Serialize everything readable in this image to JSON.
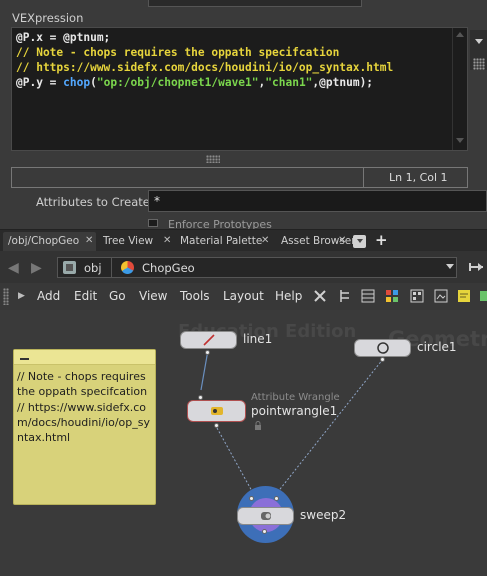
{
  "parameter_pane": {
    "vex_label": "VEXpression",
    "code_lines": [
      [
        {
          "t": "@P.x = @ptnum;",
          "c": "plain"
        }
      ],
      [
        {
          "t": "// Note - chops requires the oppath specifcation",
          "c": "comment"
        }
      ],
      [
        {
          "t": "// https://www.sidefx.com/docs/houdini/io/op_syntax.html",
          "c": "comment"
        }
      ],
      [
        {
          "t": "@P.y = ",
          "c": "plain"
        },
        {
          "t": "chop",
          "c": "func"
        },
        {
          "t": "(",
          "c": "plain"
        },
        {
          "t": "\"op:/obj/chopnet1/wave1\"",
          "c": "str"
        },
        {
          "t": ",",
          "c": "plain"
        },
        {
          "t": "\"chan1\"",
          "c": "str"
        },
        {
          "t": ",@ptnum);",
          "c": "plain"
        }
      ]
    ],
    "cursor_status": "Ln 1, Col 1",
    "attributes_label": "Attributes to Create",
    "attributes_value": "*",
    "enforce_label": "Enforce Prototypes"
  },
  "tabs": [
    {
      "label": "/obj/ChopGeo",
      "active": true
    },
    {
      "label": "Tree View",
      "active": false
    },
    {
      "label": "Material Palette",
      "active": false
    },
    {
      "label": "Asset Browser",
      "active": false
    }
  ],
  "tab_add_label": "+",
  "path_bar": {
    "root": "obj",
    "current": "ChopGeo"
  },
  "menu": [
    "Add",
    "Edit",
    "Go",
    "View",
    "Tools",
    "Layout",
    "Help"
  ],
  "network": {
    "watermark_left": "Education Edition",
    "watermark_right": "Geometry",
    "sticky_note": "// Note - chops requires the oppath specifcation // https://www.sidefx.com/docs/houdini/io/op_syntax.html",
    "nodes": [
      {
        "id": "line1",
        "label": "line1",
        "type_label": ""
      },
      {
        "id": "circle1",
        "label": "circle1",
        "type_label": ""
      },
      {
        "id": "pointwrangle1",
        "label": "pointwrangle1",
        "type_label": "Attribute Wrangle"
      },
      {
        "id": "sweep2",
        "label": "sweep2",
        "type_label": ""
      }
    ]
  },
  "colors": {
    "comment": "#e6d43c",
    "function": "#53a8ff",
    "string": "#7bd64d",
    "sticky_note": "#d8d27a",
    "sweep_ring": "#3d6fb8",
    "sweep_glow": "#8a6fd8"
  }
}
